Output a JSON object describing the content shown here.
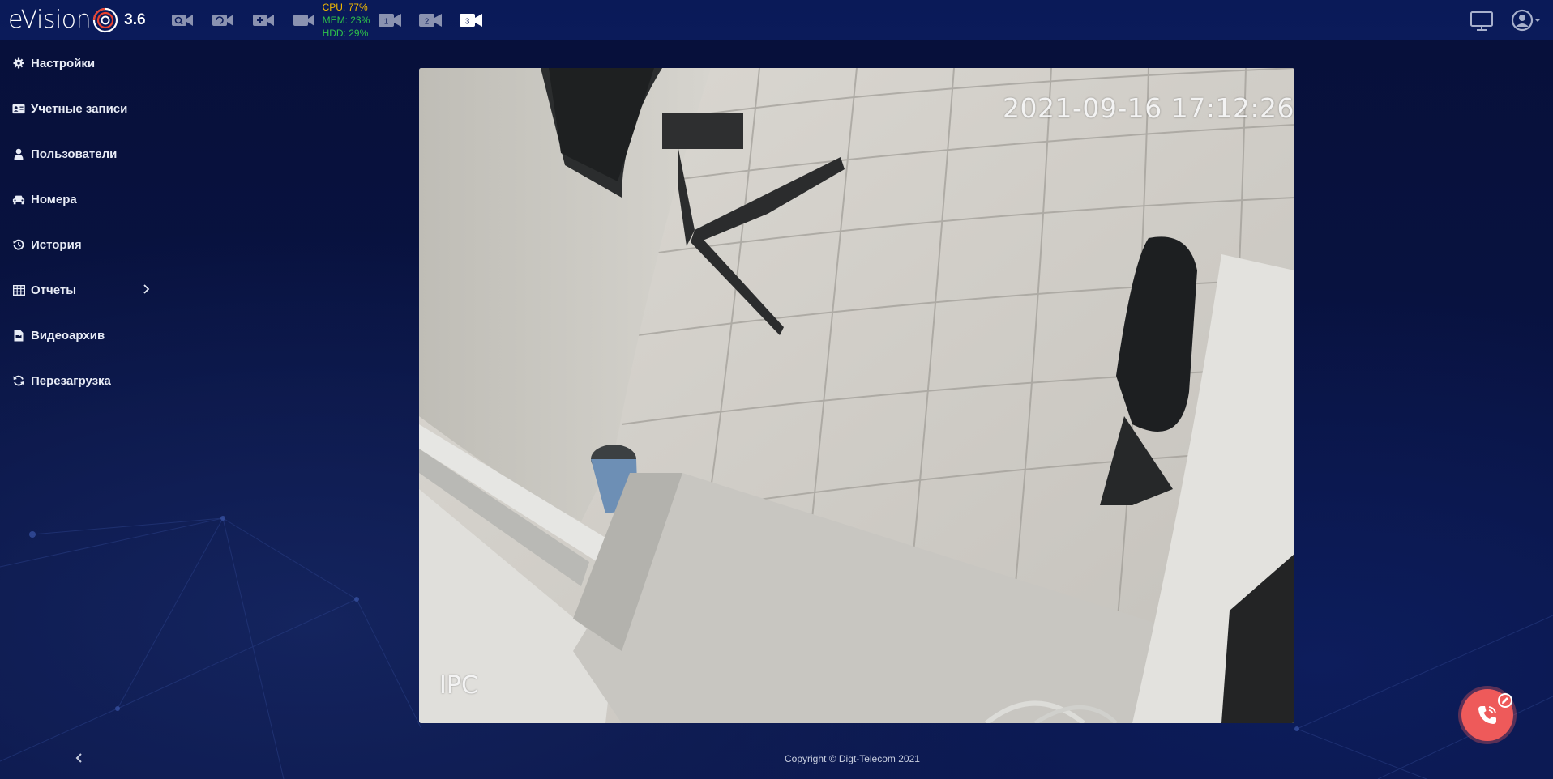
{
  "app": {
    "logo_text": "eVision",
    "version": "3.6"
  },
  "toolbar": {
    "camera_icons": [
      "camera-search-icon",
      "camera-refresh-icon",
      "camera-add-icon",
      "camera-icon"
    ],
    "stats": {
      "cpu": "CPU: 77%",
      "mem": "MEM: 23%",
      "hdd": "HDD: 29%"
    },
    "camera_numbers": [
      "1",
      "2",
      "3"
    ],
    "active_camera": "3",
    "right_icons": [
      "monitor-icon",
      "user-icon"
    ]
  },
  "sidebar": {
    "items": [
      {
        "label": "Настройки",
        "icon": "gear-icon"
      },
      {
        "label": "Учетные записи",
        "icon": "id-card-icon"
      },
      {
        "label": "Пользователи",
        "icon": "user-icon"
      },
      {
        "label": "Номера",
        "icon": "car-icon"
      },
      {
        "label": "История",
        "icon": "history-icon"
      },
      {
        "label": "Отчеты",
        "icon": "table-icon",
        "has_submenu": true
      },
      {
        "label": "Видеоархив",
        "icon": "video-file-icon"
      },
      {
        "label": "Перезагрузка",
        "icon": "refresh-icon"
      }
    ]
  },
  "video": {
    "timestamp": "2021-09-16 17:12:26",
    "camera_label": "IPC"
  },
  "footer": {
    "copyright": "Copyright © Digt-Telecom 2021"
  },
  "colors": {
    "background": "#08123d",
    "topbar": "#0b1b5a",
    "cpu": "#f2b900",
    "mem": "#2ec24a",
    "call_button": "#ee5a5a"
  }
}
